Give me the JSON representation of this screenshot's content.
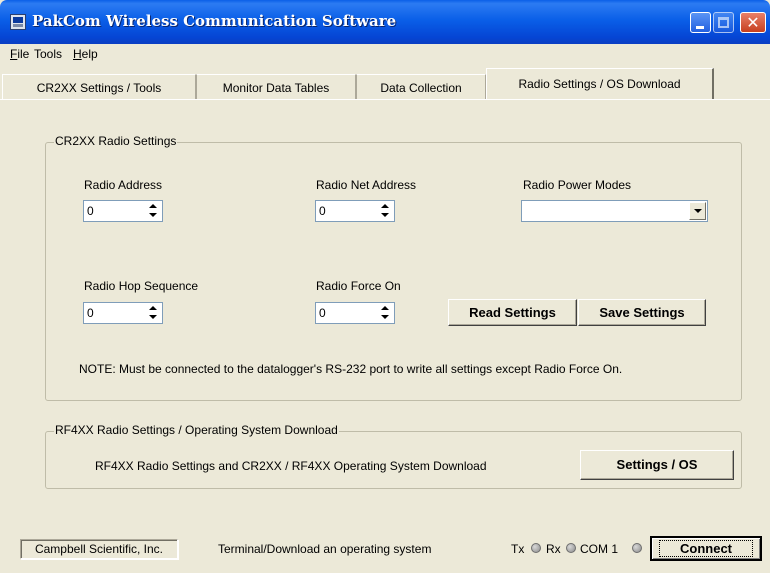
{
  "window": {
    "title": "PakCom Wireless Communication Software"
  },
  "titlebar_buttons": {
    "minimize_icon": "minimize-icon",
    "maximize_icon": "maximize-icon",
    "close_icon": "close-icon",
    "close_glyph": "✕"
  },
  "menu": {
    "file": "File",
    "file_rest": "ile",
    "file_key": "F",
    "tools": "Tools",
    "help_key": "H",
    "help_rest": "elp"
  },
  "tabs": [
    {
      "label": "CR2XX Settings / Tools"
    },
    {
      "label": "Monitor Data Tables"
    },
    {
      "label": "Data Collection"
    },
    {
      "label": "Radio Settings / OS Download",
      "selected": true
    }
  ],
  "cr2xx": {
    "group_title": "CR2XX Radio Settings",
    "radio_address": {
      "label": "Radio Address",
      "value": "0"
    },
    "radio_net_address": {
      "label": "Radio Net Address",
      "value": "0"
    },
    "radio_power_modes": {
      "label": "Radio Power Modes",
      "value": ""
    },
    "radio_hop_sequence": {
      "label": "Radio Hop Sequence",
      "value": "0"
    },
    "radio_force_on": {
      "label": "Radio Force On",
      "value": "0"
    },
    "read_button": "Read Settings",
    "save_button": "Save Settings",
    "note": "NOTE: Must be connected to the datalogger's RS-232 port to write all settings except Radio Force On."
  },
  "rf4xx": {
    "group_title": "RF4XX Radio Settings / Operating System Download",
    "description": "RF4XX Radio Settings and CR2XX / RF4XX Operating System Download",
    "button": "Settings / OS"
  },
  "status": {
    "company": "Campbell Scientific, Inc.",
    "message": "Terminal/Download an operating system",
    "tx": "Tx",
    "rx": "Rx",
    "com": "COM 1",
    "connect_button": "Connect"
  }
}
